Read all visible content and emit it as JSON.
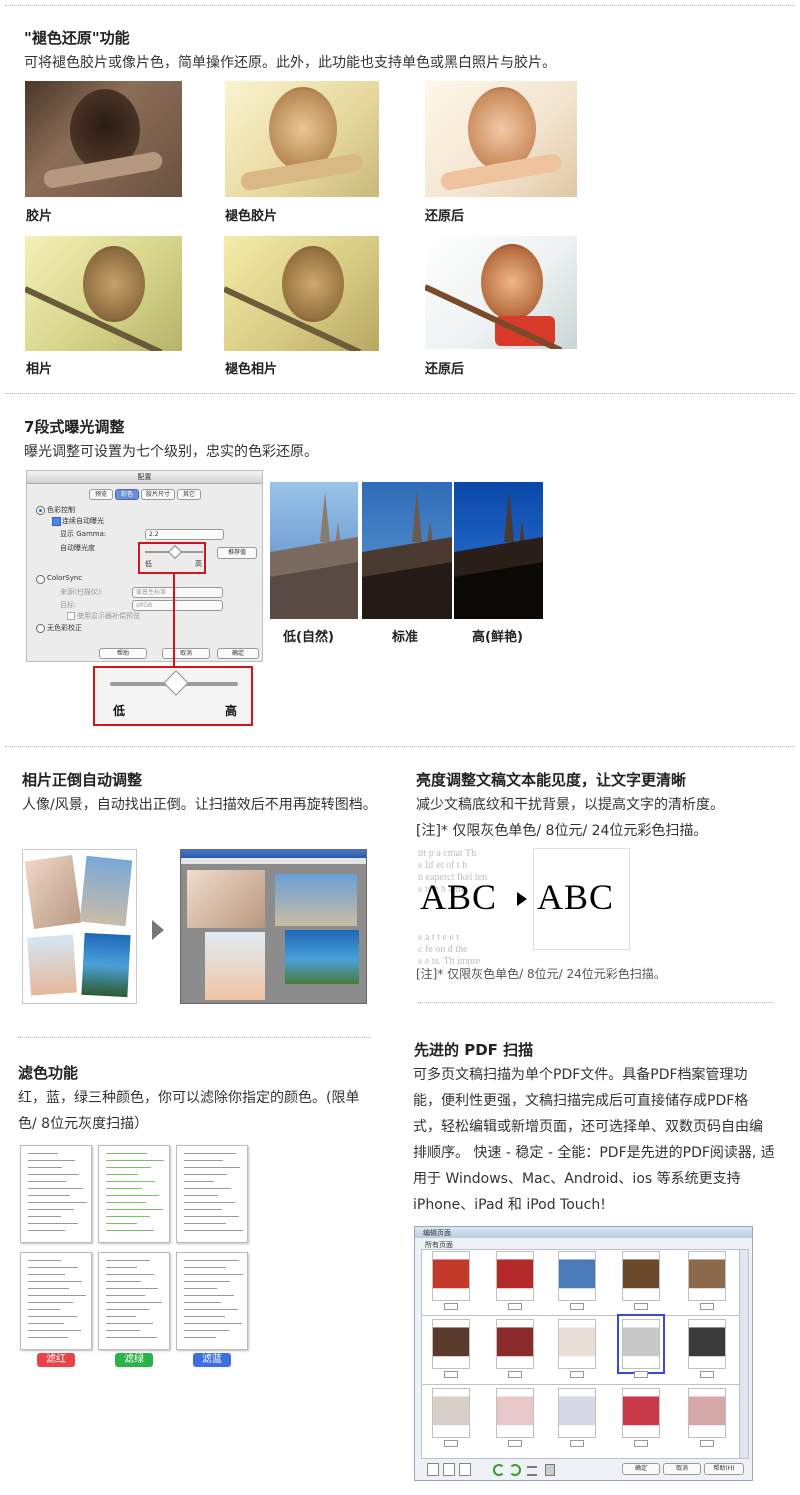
{
  "sections": {
    "restore": {
      "title": "\"褪色还原\"功能",
      "desc": "可将褪色胶片或像片色，简单操作还原。此外，此功能也支持单色或黑白照片与胶片。",
      "captions": [
        "胶片",
        "褪色胶片",
        "还原后",
        "相片",
        "褪色相片",
        "还原后"
      ]
    },
    "exposure": {
      "title": "7段式曝光调整",
      "desc": "曝光调整可设置为七个级别，忠实的色彩还原。",
      "dialog": {
        "window_title": "配置",
        "tabs": [
          "预览",
          "彩色",
          "胶片尺寸",
          "其它"
        ],
        "radio_color_control": "色彩控制",
        "check_auto_exposure": "连续自动曝光",
        "gamma_label": "显示 Gamma:",
        "gamma_value": "2.2",
        "auto_exposure_level": "自动曝光度",
        "recommend_button": "推荐值",
        "slider_low": "低",
        "slider_high": "高",
        "colorsync": "ColorSync",
        "source_label": "来源(扫描仪):",
        "source_value": "爱普生标准",
        "target_label": "目标:",
        "target_value": "sRGB",
        "use_monitor": "使用显示器补偿预览",
        "no_color_correction": "无色彩校正",
        "help_button": "帮助",
        "cancel_button": "取消",
        "ok_button": "确定"
      },
      "zoom_low": "低",
      "zoom_high": "高",
      "levels": [
        "低(自然)",
        "标准",
        "高(鲜艳)"
      ]
    },
    "auto_rotate": {
      "title": "相片正倒自动调整",
      "desc": "人像/风景，自动找出正倒。让扫描效后不用再旋转图档。"
    },
    "text_enhance": {
      "title": "亮度调整文稿文本能见度，让文字更清晰",
      "desc1": "减少文稿底纹和干扰背景，以提高文字的清析度。",
      "desc2": "[注]* 仅限灰色单色/ 8位元/ 24位元彩色扫描。",
      "abc_before": "ABC",
      "abc_after": "ABC",
      "note": "[注]* 仅限灰色单色/ 8位元/ 24位元彩色扫描。"
    },
    "filter": {
      "title": "滤色功能",
      "desc": "红，蓝，绿三种颜色，你可以滤除你指定的颜色。(限单色/ 8位元灰度扫描）",
      "tags": [
        "滤红",
        "滤绿",
        "滤蓝"
      ]
    },
    "pdf": {
      "title": "先进的 PDF 扫描",
      "desc": "可多页文稿扫描为单个PDF文件。具备PDF档案管理功能，便利性更强，文稿扫描完成后可直接储存成PDF格式，轻松编辑或新增页面，还可选择单、双数页码自由编排顺序。 快速 - 稳定 - 全能：PDF是先进的PDF阅读器, 适用于 Windows、Mac、Android、ios 等系统更支持 iPhone、iPad 和 iPod Touch!",
      "window_title": "编辑页面",
      "toolbar_label": "所有页面",
      "buttons": [
        "确定",
        "取消",
        "帮助(H)"
      ]
    }
  },
  "colors": {
    "accent_red": "#d2141c",
    "filter_red": "#e8434b",
    "filter_green": "#2bb34a",
    "filter_blue": "#3d6fe0"
  }
}
